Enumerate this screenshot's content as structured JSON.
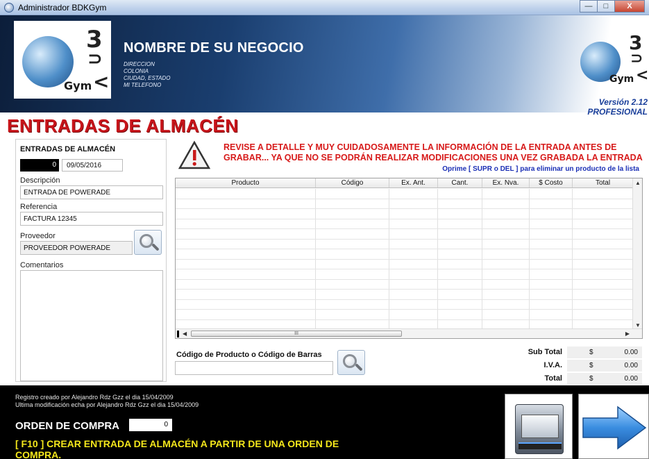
{
  "window": {
    "title": "Administrador BDKGym",
    "minimize": "—",
    "maximize": "□",
    "close": "X"
  },
  "header": {
    "business_name": "NOMBRE DE SU NEGOCIO",
    "address_lines": [
      "DIRECCION",
      "COLONIA",
      "CIUDAD, ESTADO",
      "MI TELEFONO"
    ],
    "logo_text": "Gym",
    "version": "Versión 2.12",
    "edition": "PROFESIONAL"
  },
  "page_title": "ENTRADAS DE ALMACÉN",
  "left_panel": {
    "heading": "ENTRADAS DE ALMACÉN",
    "number": "0",
    "date": "09/05/2016",
    "description_label": "Descripción",
    "description_value": "ENTRADA DE POWERADE",
    "reference_label": "Referencia",
    "reference_value": "FACTURA 12345",
    "provider_label": "Proveedor",
    "provider_value": "PROVEEDOR POWERADE",
    "comments_label": "Comentarios",
    "comments_value": ""
  },
  "warning": {
    "text": "REVISE A DETALLE Y MUY CUIDADOSAMENTE LA INFORMACIÓN DE LA ENTRADA ANTES DE GRABAR... YA QUE NO SE PODRÁN REALIZAR MODIFICACIONES UNA VEZ GRABADA LA ENTRADA",
    "hint": "Oprime [ SUPR o DEL ] para eliminar un producto de la lista"
  },
  "grid": {
    "columns": [
      "Producto",
      "Código",
      "Ex. Ant.",
      "Cant.",
      "Ex. Nva.",
      "$ Costo",
      "Total"
    ],
    "rows": [],
    "scroll_thumb": "III"
  },
  "code_search": {
    "label": "Código de Producto o Código de Barras",
    "value": ""
  },
  "totals": {
    "currency": "$",
    "rows": [
      {
        "label": "Sub Total",
        "value": "0.00"
      },
      {
        "label": "I.V.A.",
        "value": "0.00"
      },
      {
        "label": "Total",
        "value": "0.00"
      }
    ]
  },
  "footer": {
    "created": "Registro creado por Alejandro Rdz Gzz el dia 15/04/2009",
    "modified": "Ultima modificación echa por Alejandro Rdz Gzz el dia 15/04/2009",
    "purchase_order_label": "ORDEN DE COMPRA",
    "purchase_order_value": "0",
    "f10_text": "[ F10 ] CREAR ENTRADA DE ALMACÉN A PARTIR DE UNA ORDEN DE COMPRA."
  },
  "colors": {
    "title_red": "#c8141a",
    "warn_red": "#d71a1a",
    "hint_blue": "#1b2fb5",
    "footer_yellow": "#f4e71b",
    "version_blue": "#1a3f9a"
  }
}
